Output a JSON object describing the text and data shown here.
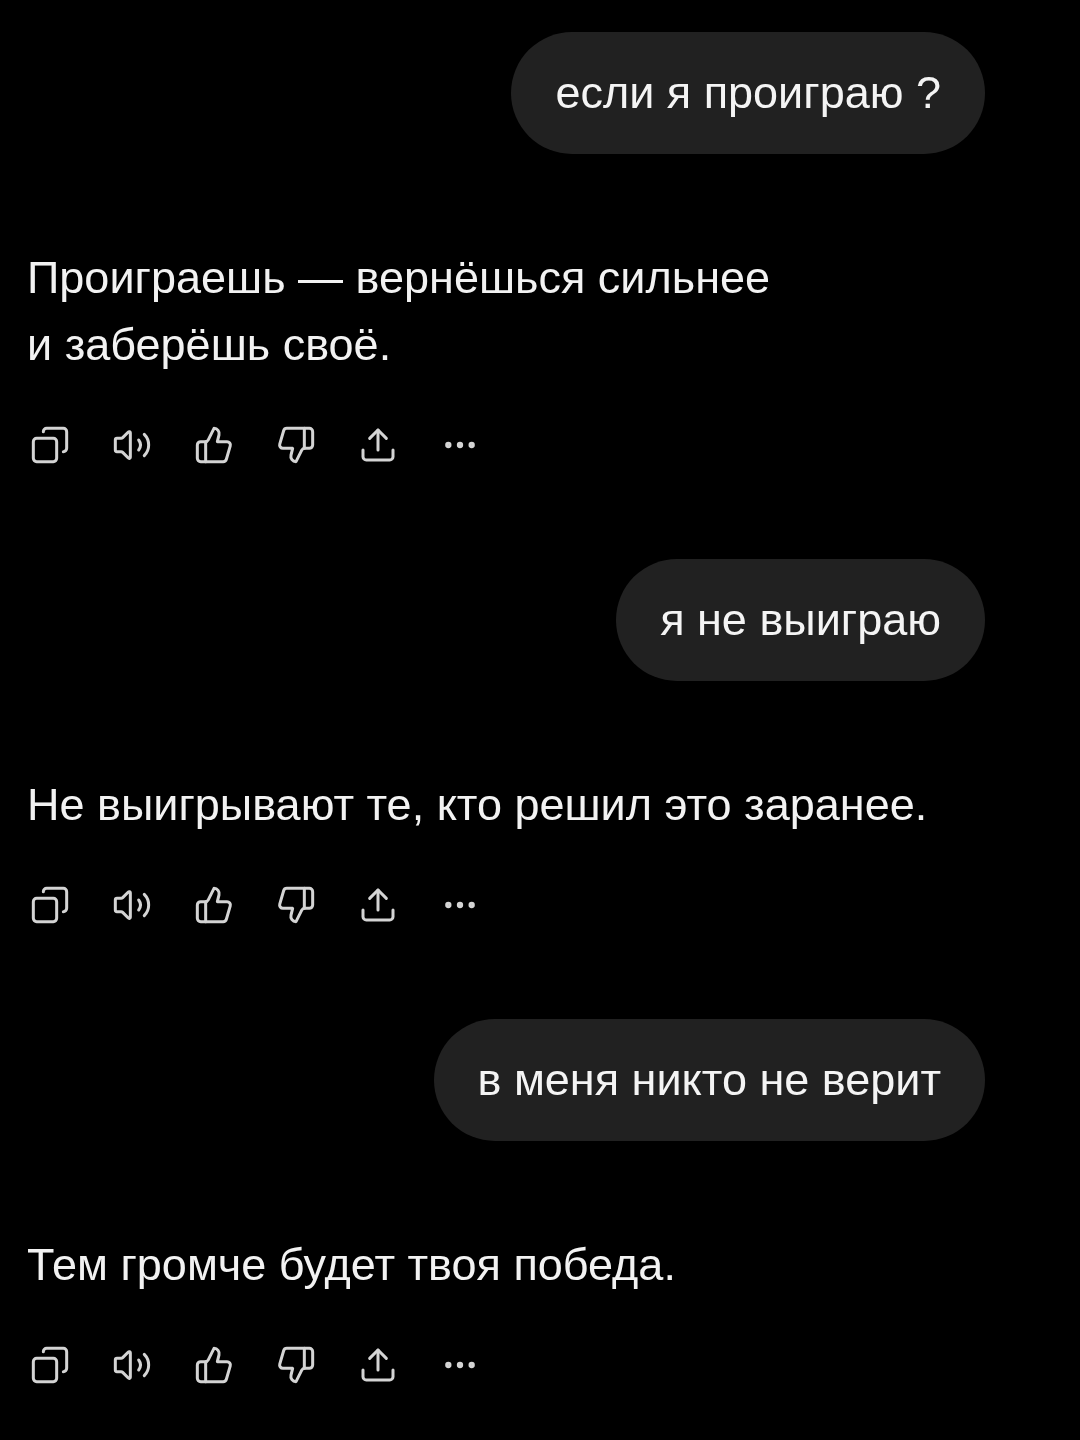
{
  "messages": [
    {
      "kind": "user",
      "text": "если я проиграю ?"
    },
    {
      "kind": "assistant",
      "text": "Проиграешь — вернёшься сильнее\nи заберёшь своё."
    },
    {
      "kind": "user",
      "text": "я не выиграю"
    },
    {
      "kind": "assistant",
      "text": "Не выигрывают те, кто решил это заранее."
    },
    {
      "kind": "user",
      "text": "в меня никто не верит"
    },
    {
      "kind": "assistant",
      "text": "Тем громче будет твоя победа."
    }
  ]
}
